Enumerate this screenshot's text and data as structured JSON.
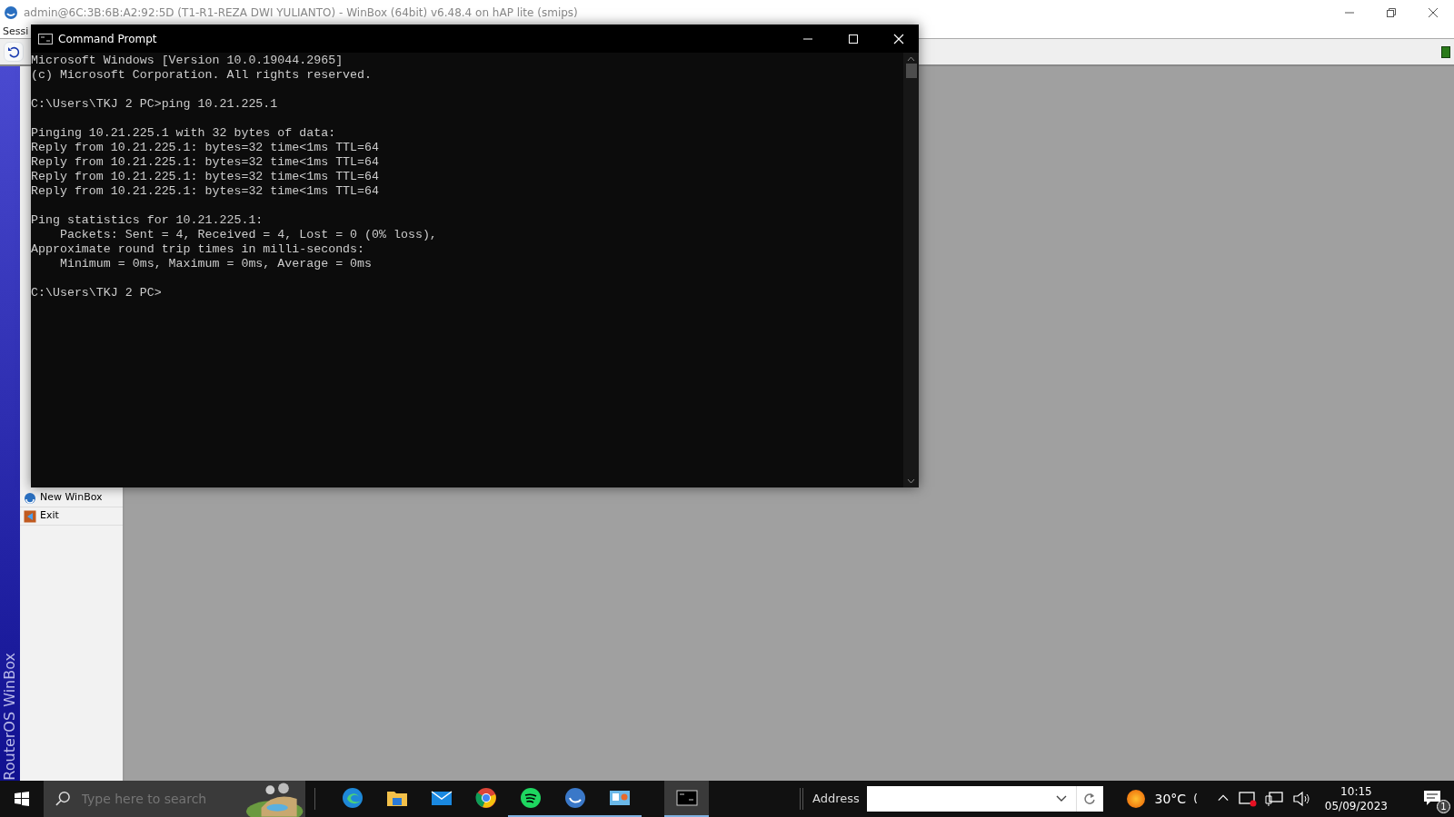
{
  "window": {
    "title": "admin@6C:3B:6B:A2:92:5D (T1-R1-REZA DWI YULIANTO) - WinBox (64bit) v6.48.4 on hAP lite (smips)"
  },
  "menu_bar": {
    "items": [
      "Sessi"
    ]
  },
  "side_banner": {
    "text": "RouterOS WinBox"
  },
  "sidebar": {
    "items": [
      {
        "label": "New WinBox"
      },
      {
        "label": "Exit"
      }
    ]
  },
  "terminal": {
    "title": "Command Prompt",
    "blocks": [
      [
        "Microsoft Windows [Version 10.0.19044.2965]",
        "(c) Microsoft Corporation. All rights reserved."
      ],
      [
        "C:\\Users\\TKJ 2 PC>ping 10.21.225.1"
      ],
      [
        "Pinging 10.21.225.1 with 32 bytes of data:",
        "Reply from 10.21.225.1: bytes=32 time<1ms TTL=64",
        "Reply from 10.21.225.1: bytes=32 time<1ms TTL=64",
        "Reply from 10.21.225.1: bytes=32 time<1ms TTL=64",
        "Reply from 10.21.225.1: bytes=32 time<1ms TTL=64"
      ],
      [
        "Ping statistics for 10.21.225.1:",
        "    Packets: Sent = 4, Received = 4, Lost = 0 (0% loss),",
        "Approximate round trip times in milli-seconds:",
        "    Minimum = 0ms, Maximum = 0ms, Average = 0ms"
      ],
      [
        "C:\\Users\\TKJ 2 PC>"
      ]
    ]
  },
  "taskbar": {
    "search": {
      "placeholder": "Type here to search"
    },
    "apps": [
      {
        "running": false,
        "selected": false
      },
      {
        "running": false,
        "selected": false
      },
      {
        "running": false,
        "selected": false
      },
      {
        "running": false,
        "selected": false
      },
      {
        "running": true,
        "selected": false
      },
      {
        "running": true,
        "selected": false
      },
      {
        "running": true,
        "selected": false
      },
      {
        "running": true,
        "selected": true
      }
    ],
    "address": {
      "label": "Address"
    },
    "weather": {
      "temperature": "30°C",
      "extra": "("
    },
    "clock": {
      "time": "10:15",
      "date": "05/09/2023"
    },
    "notifications": {
      "count": "1"
    }
  }
}
